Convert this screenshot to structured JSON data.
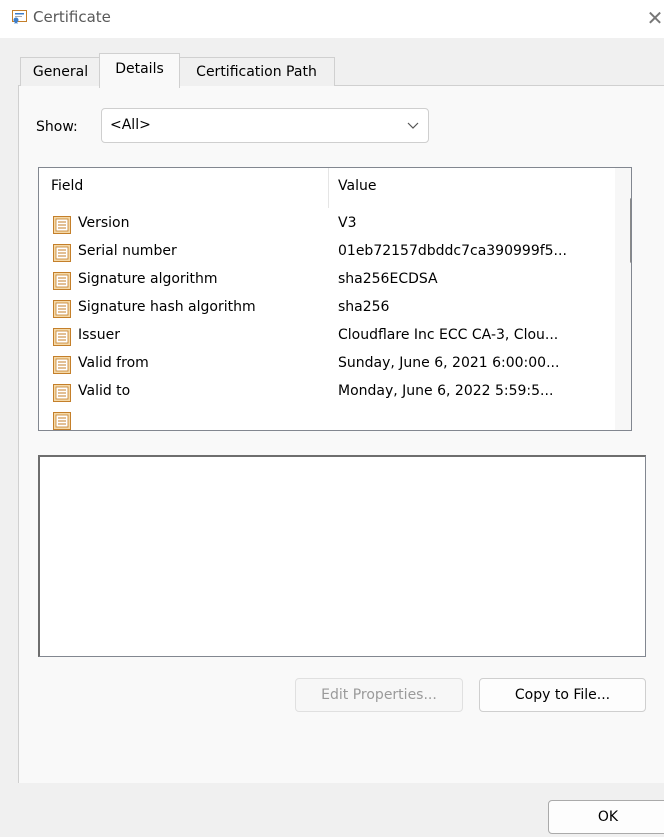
{
  "window": {
    "title": "Certificate",
    "icon": "certificate-icon",
    "close_glyph": "✕"
  },
  "tabs": [
    {
      "label": "General",
      "active": false
    },
    {
      "label": "Details",
      "active": true
    },
    {
      "label": "Certification Path",
      "active": false
    }
  ],
  "show": {
    "label": "Show:",
    "value": "<All>"
  },
  "list": {
    "columns": [
      "Field",
      "Value"
    ],
    "rows": [
      {
        "field": "Version",
        "value": "V3"
      },
      {
        "field": "Serial number",
        "value": "01eb72157dbddc7ca390999f5..."
      },
      {
        "field": "Signature algorithm",
        "value": "sha256ECDSA"
      },
      {
        "field": "Signature hash algorithm",
        "value": "sha256"
      },
      {
        "field": "Issuer",
        "value": "Cloudflare Inc ECC CA-3, Clou..."
      },
      {
        "field": "Valid from",
        "value": "Sunday, June 6, 2021 6:00:00..."
      },
      {
        "field": "Valid to",
        "value": "Monday, June 6, 2022 5:59:5..."
      },
      {
        "field": "",
        "value": ""
      }
    ]
  },
  "buttons": {
    "edit_properties": "Edit Properties...",
    "copy_to_file": "Copy to File...",
    "ok": "OK"
  },
  "colors": {
    "field_icon_fill": "#f5d9a8",
    "field_icon_border": "#c47f2a"
  }
}
